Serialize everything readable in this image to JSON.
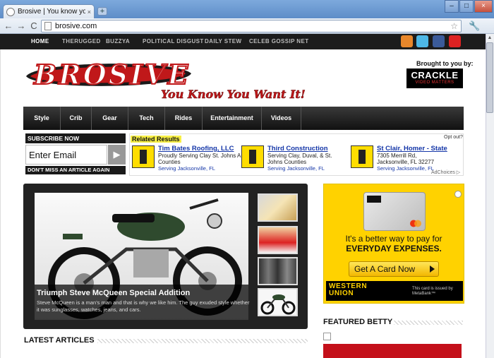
{
  "browser": {
    "tab_title": "Brosive | You know you want it",
    "tab_close": "×",
    "new_tab": "+",
    "url": "brosive.com",
    "controls": [
      "–",
      "□",
      "×"
    ],
    "nav": {
      "back": "←",
      "forward": "→",
      "reload": "C"
    },
    "star": "☆",
    "wrench": "🔧"
  },
  "topnav": {
    "items": [
      "HOME",
      "THERUGGED",
      "BUZZYA",
      "POLITICAL DISGUST",
      "DAILY STEW",
      "CELEB GOSSIP NET"
    ]
  },
  "social": [
    {
      "icon": "rss-icon",
      "color": "#e8872b"
    },
    {
      "icon": "twitter-icon",
      "color": "#4db7e6"
    },
    {
      "icon": "facebook-icon",
      "color": "#3b5b9a"
    },
    {
      "icon": "youtube-icon",
      "color": "#d22"
    }
  ],
  "header": {
    "logo_text": "BROSIVE",
    "tagline": "You Know You Want It!",
    "sponsor_label": "Brought to you by:",
    "sponsor_name": "CRACKLE",
    "sponsor_sub": "VIDEO MATTERS"
  },
  "categories": [
    "Style",
    "Crib",
    "Gear",
    "Tech",
    "Rides",
    "Entertainment",
    "Videos"
  ],
  "subscribe": {
    "heading": "SUBSCRIBE NOW",
    "input_value": "Enter Email",
    "button": "▶",
    "footer": "DON'T MISS AN ARTICLE AGAIN"
  },
  "ad": {
    "header": "Related Results",
    "opt_out": "Opt out?",
    "adchoices": "AdChoices ▷",
    "listings": [
      {
        "title": "Tim Bates Roofing, LLC",
        "desc": "Proudly Serving Clay St. Johns And Duval Counties",
        "loc": "Serving Jacksonville, FL"
      },
      {
        "title": "Third Construction",
        "desc": "Serving Clay, Duval, & St. Johns Counties",
        "loc": "Serving Jacksonville, FL"
      },
      {
        "title": "St Clair, Homer - State",
        "desc": "7305 Merrill Rd, Jacksonville, FL 32277",
        "loc": "Serving Jacksonville, FL"
      }
    ]
  },
  "featured": {
    "title": "Triumph Steve McQueen Special Addition",
    "desc": "Steve McQueen is a man's man and that is why we like him. The guy exuded style whether it was sunglasses, watches, jeans, and cars."
  },
  "sections": {
    "latest": "LATEST ARTICLES",
    "featured_betty": "FEATURED BETTY"
  },
  "wu_ad": {
    "line1": "It's a better way to pay for",
    "line2": "EVERYDAY EXPENSES.",
    "cta": "Get A Card Now",
    "brand_line1": "WESTERN",
    "brand_line2": "UNION",
    "note": "This card is issued by MetaBank™"
  }
}
